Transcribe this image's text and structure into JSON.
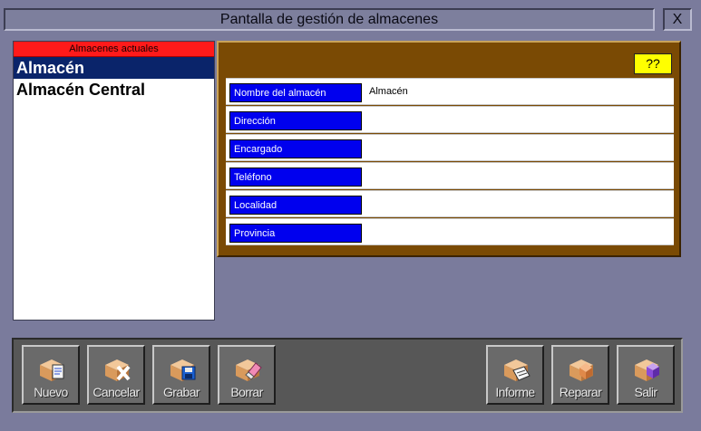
{
  "window": {
    "title": "Pantalla de gestión de almacenes",
    "close_label": "X"
  },
  "list": {
    "header": "Almacenes actuales",
    "items": [
      {
        "label": "Almacén",
        "selected": true
      },
      {
        "label": "Almacén Central",
        "selected": false
      }
    ]
  },
  "form": {
    "help_label": "??",
    "fields": [
      {
        "label": "Nombre del almacén",
        "value": "Almacén"
      },
      {
        "label": "Dirección",
        "value": ""
      },
      {
        "label": "Encargado",
        "value": ""
      },
      {
        "label": "Teléfono",
        "value": ""
      },
      {
        "label": "Localidad",
        "value": ""
      },
      {
        "label": "Provincia",
        "value": ""
      }
    ]
  },
  "toolbar": {
    "buttons": [
      {
        "label": "Nuevo",
        "icon": "new-document-icon"
      },
      {
        "label": "Cancelar",
        "icon": "cancel-icon"
      },
      {
        "label": "Grabar",
        "icon": "save-icon"
      },
      {
        "label": "Borrar",
        "icon": "erase-icon"
      },
      {
        "label": "Informe",
        "icon": "report-icon"
      },
      {
        "label": "Reparar",
        "icon": "repair-icon"
      },
      {
        "label": "Salir",
        "icon": "exit-icon"
      }
    ]
  },
  "colors": {
    "list_header": "#ff1a1a",
    "selected_item": "#0a246a",
    "form_panel": "#7a4a04",
    "field_label": "#0000ee",
    "help_button": "#ffff00"
  }
}
